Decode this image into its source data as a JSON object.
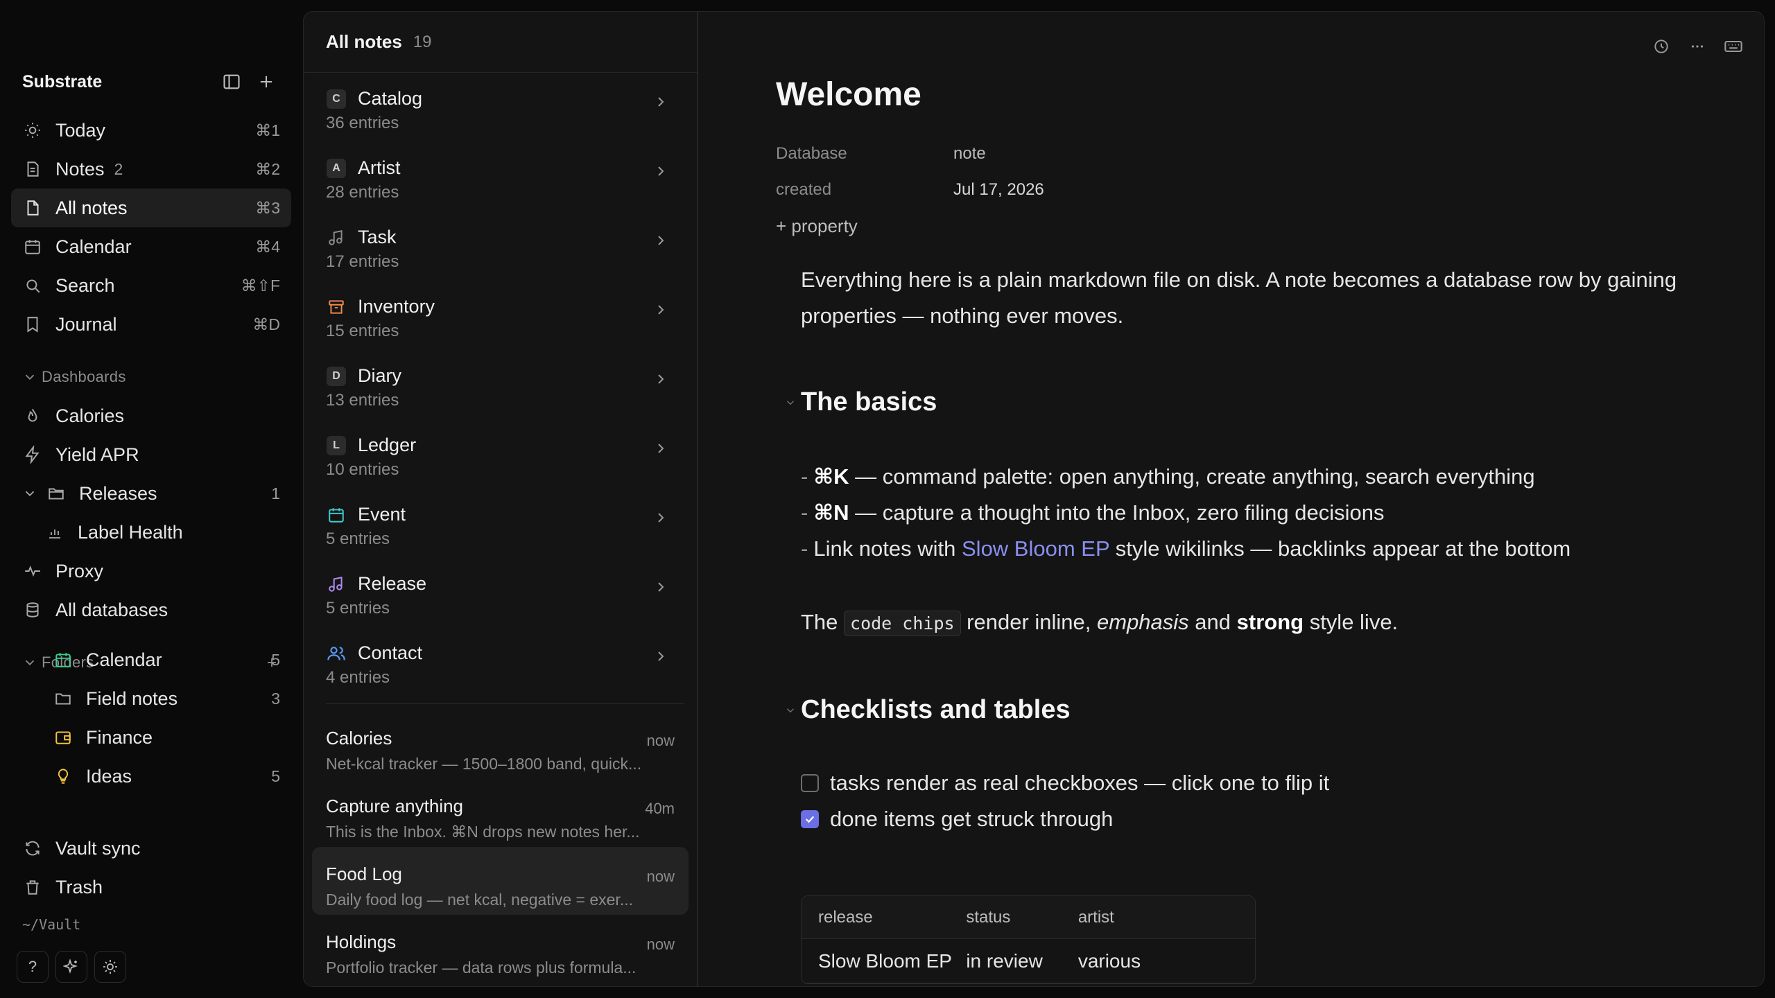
{
  "sidebar": {
    "title": "Substrate",
    "nav": [
      {
        "label": "Today",
        "shortcut": "⌘1",
        "icon": "sun-icon"
      },
      {
        "label": "Notes",
        "badge": "2",
        "shortcut": "⌘2",
        "icon": "note-icon"
      },
      {
        "label": "All notes",
        "shortcut": "⌘3",
        "icon": "file-icon",
        "active": true
      },
      {
        "label": "Calendar",
        "shortcut": "⌘4",
        "icon": "calendar-icon"
      },
      {
        "label": "Search",
        "shortcut": "⌘⇧F",
        "icon": "search-icon"
      },
      {
        "label": "Journal",
        "shortcut": "⌘D",
        "icon": "book-icon"
      }
    ],
    "dashboards_label": "Dashboards",
    "dashboards": [
      {
        "label": "Calories",
        "icon": "flame-icon"
      },
      {
        "label": "Yield APR",
        "icon": "bolt-icon"
      },
      {
        "label": "Releases",
        "count": "1",
        "icon": "folder-icon"
      },
      {
        "label": "Label Health",
        "icon": "bar-chart-icon"
      },
      {
        "label": "Proxy",
        "icon": "pulse-icon"
      },
      {
        "label": "All databases",
        "icon": "database-icon"
      }
    ],
    "folders_label": "Folders",
    "folders": [
      {
        "label": "Calendar",
        "count": "5",
        "icon": "calendar-icon",
        "color": "#3ecf8e"
      },
      {
        "label": "Field notes",
        "count": "3",
        "icon": "folder-icon",
        "color": "#a9a9a9"
      },
      {
        "label": "Finance",
        "count": "",
        "icon": "wallet-icon",
        "color": "#f5c542"
      },
      {
        "label": "Ideas",
        "count": "5",
        "icon": "bulb-icon",
        "color": "#f5c542"
      }
    ],
    "bottom": [
      {
        "label": "Vault sync",
        "icon": "sync-icon"
      },
      {
        "label": "Trash",
        "icon": "trash-icon"
      }
    ],
    "vault_path": "~/Vault",
    "tools": [
      "?"
    ]
  },
  "list": {
    "title": "All notes",
    "count": "19",
    "databases": [
      {
        "name": "Catalog",
        "sub": "36 entries",
        "letter": "C"
      },
      {
        "name": "Artist",
        "sub": "28 entries",
        "letter": "A"
      },
      {
        "name": "Task",
        "sub": "17 entries",
        "icon": "music-note-icon"
      },
      {
        "name": "Inventory",
        "sub": "15 entries",
        "icon": "archive-icon"
      },
      {
        "name": "Diary",
        "sub": "13 entries",
        "letter": "D"
      },
      {
        "name": "Ledger",
        "sub": "10 entries",
        "letter": "L"
      },
      {
        "name": "Event",
        "sub": "5 entries",
        "icon": "calendar-icon"
      },
      {
        "name": "Release",
        "sub": "5 entries",
        "icon": "music-icon"
      },
      {
        "name": "Contact",
        "sub": "4 entries",
        "icon": "users-icon"
      }
    ],
    "notes": [
      {
        "title": "Calories",
        "time": "now",
        "preview": "Net-kcal tracker — 1500–1800 band, quick..."
      },
      {
        "title": "Capture anything",
        "time": "40m",
        "preview": "This is the Inbox. ⌘N drops new notes her..."
      },
      {
        "title": "Food Log",
        "time": "now",
        "preview": "Daily food log — net kcal, negative = exer...",
        "selected": true
      },
      {
        "title": "Holdings",
        "time": "now",
        "preview": "Portfolio tracker — data rows plus formula..."
      }
    ]
  },
  "editor": {
    "title": "Welcome",
    "props": [
      {
        "key": "Database",
        "value": "note"
      },
      {
        "key": "created",
        "value": "Jul 17, 2026"
      }
    ],
    "add_property": "+ property",
    "intro": "Everything here is a plain markdown file on disk. A note becomes a database row by gaining properties — nothing ever moves.",
    "h_basics": "The basics",
    "bullets": [
      {
        "dash": "-",
        "key": "⌘K",
        "text": " — command palette: open anything, create anything, search everything"
      },
      {
        "dash": "-",
        "key": "⌘N",
        "text": " — capture a thought into the Inbox, zero filing decisions"
      }
    ],
    "bullet3": {
      "dash": "-",
      "pre": "Link notes with ",
      "link": "Slow Bloom EP",
      "post": " style wikilinks — backlinks appear at the bottom"
    },
    "inline": {
      "pre": "The ",
      "code": "code chips",
      "mid": " render inline, ",
      "em": "emphasis",
      "and": " and ",
      "strong": "strong",
      "post": " style live."
    },
    "h_checklists": "Checklists and tables",
    "checks": [
      {
        "label": "tasks render as real checkboxes — click one to flip it",
        "checked": false
      },
      {
        "label": "done items get struck through",
        "checked": true
      }
    ],
    "table": {
      "headers": [
        "release",
        "status",
        "artist"
      ],
      "rows": [
        [
          "Slow Bloom EP",
          "in review",
          "various"
        ]
      ]
    }
  }
}
